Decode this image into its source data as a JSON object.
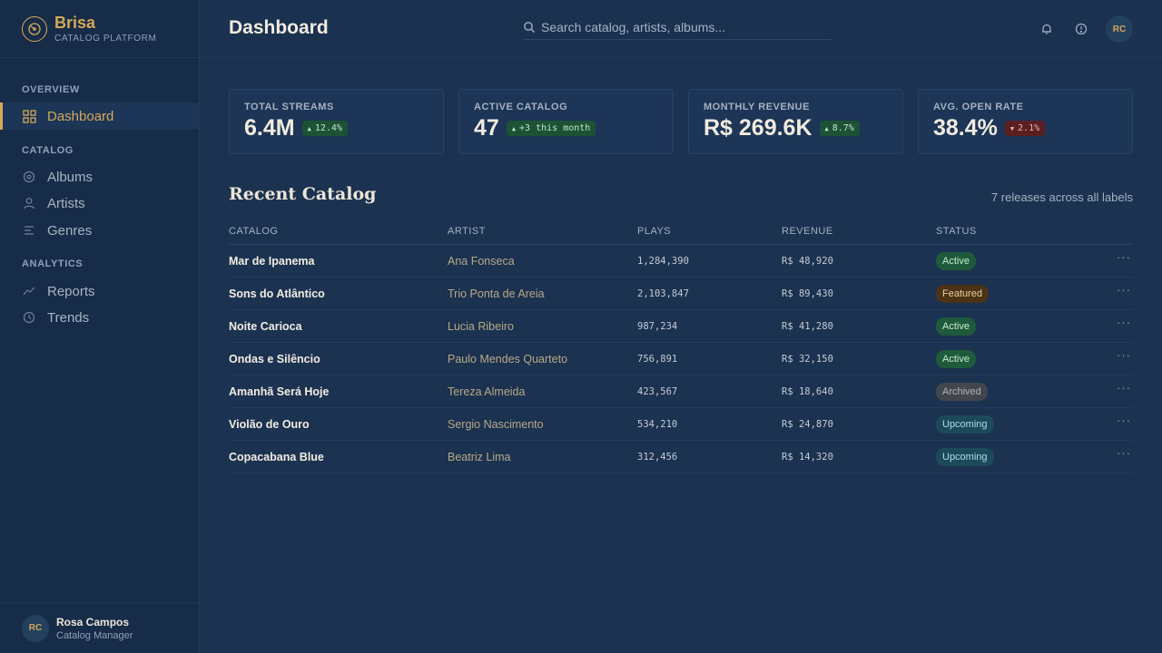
{
  "brand": {
    "name": "Brisa",
    "subtitle": "CATALOG PLATFORM",
    "logo_icon": "disc-logo-icon"
  },
  "sidebar": {
    "sections": [
      {
        "title": "OVERVIEW",
        "items": [
          {
            "label": "Dashboard",
            "icon": "grid-icon",
            "active": true
          }
        ]
      },
      {
        "title": "CATALOG",
        "items": [
          {
            "label": "Albums",
            "icon": "disc-icon"
          },
          {
            "label": "Artists",
            "icon": "person-icon"
          },
          {
            "label": "Genres",
            "icon": "list-icon"
          }
        ]
      },
      {
        "title": "ANALYTICS",
        "items": [
          {
            "label": "Reports",
            "icon": "trend-line-icon"
          },
          {
            "label": "Trends",
            "icon": "clock-icon"
          }
        ]
      }
    ],
    "user": {
      "initials": "RC",
      "name": "Rosa Campos",
      "role": "Catalog Manager"
    }
  },
  "header": {
    "title": "Dashboard",
    "search_placeholder": "Search catalog, artists, albums...",
    "user_initials": "RC"
  },
  "stats": [
    {
      "label": "TOTAL STREAMS",
      "value": "6.4M",
      "delta": "12.4%",
      "trend": "up"
    },
    {
      "label": "ACTIVE CATALOG",
      "value": "47",
      "delta": "+3 this month",
      "trend": "up"
    },
    {
      "label": "MONTHLY REVENUE",
      "value": "R$ 269.6K",
      "delta": "8.7%",
      "trend": "up"
    },
    {
      "label": "AVG. OPEN RATE",
      "value": "38.4%",
      "delta": "2.1%",
      "trend": "down"
    }
  ],
  "recent": {
    "title": "Recent Catalog",
    "meta": "7 releases across all labels",
    "columns": [
      "CATALOG",
      "ARTIST",
      "PLAYS",
      "REVENUE",
      "STATUS"
    ],
    "rows": [
      {
        "name": "Mar de Ipanema",
        "artist": "Ana Fonseca",
        "plays": "1,284,390",
        "revenue": "R$ 48,920",
        "status": "Active"
      },
      {
        "name": "Sons do Atlântico",
        "artist": "Trio Ponta de Areia",
        "plays": "2,103,847",
        "revenue": "R$ 89,430",
        "status": "Featured"
      },
      {
        "name": "Noite Carioca",
        "artist": "Lucia Ribeiro",
        "plays": "987,234",
        "revenue": "R$ 41,280",
        "status": "Active"
      },
      {
        "name": "Ondas e Silêncio",
        "artist": "Paulo Mendes Quarteto",
        "plays": "756,891",
        "revenue": "R$ 32,150",
        "status": "Active"
      },
      {
        "name": "Amanhã Será Hoje",
        "artist": "Tereza Almeida",
        "plays": "423,567",
        "revenue": "R$ 18,640",
        "status": "Archived"
      },
      {
        "name": "Violão de Ouro",
        "artist": "Sergio Nascimento",
        "plays": "534,210",
        "revenue": "R$ 24,870",
        "status": "Upcoming"
      },
      {
        "name": "Copacabana Blue",
        "artist": "Beatriz Lima",
        "plays": "312,456",
        "revenue": "R$ 14,320",
        "status": "Upcoming"
      }
    ]
  },
  "colors": {
    "accent": "#d4a85a",
    "background": "#1b3250",
    "sidebar": "#172c48"
  }
}
